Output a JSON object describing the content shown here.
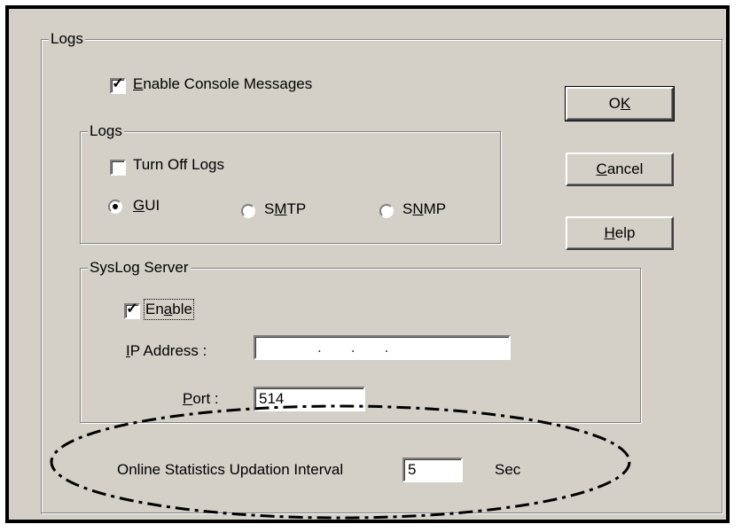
{
  "outer_group": {
    "legend": "Logs"
  },
  "console": {
    "label_first": "E",
    "label_rest": "nable Console Messages",
    "checked": true
  },
  "logs_group": {
    "legend": "Logs",
    "turn_off_label": "Turn Off Logs",
    "turn_off_checked": false,
    "radios": [
      {
        "pre": "",
        "u": "G",
        "post": "UI",
        "selected": true
      },
      {
        "pre": "S",
        "u": "M",
        "post": "TP",
        "selected": false
      },
      {
        "pre": "S",
        "u": "N",
        "post": "MP",
        "selected": false
      }
    ]
  },
  "syslog": {
    "legend": "SysLog Server",
    "enable_pre": "En",
    "enable_u": "a",
    "enable_post": "ble",
    "enable_checked": true,
    "ip_label_u": "I",
    "ip_label_rest": "P Address :",
    "ip_value": ".       .       .",
    "port_label_u": "P",
    "port_label_rest": "ort :",
    "port_value": "514"
  },
  "stats": {
    "label": "Online Statistics Updation Interval",
    "value": "5",
    "unit": "Sec"
  },
  "buttons": {
    "ok_pre": "O",
    "ok_u": "K",
    "cancel_u": "C",
    "cancel_rest": "ancel",
    "help_u": "H",
    "help_rest": "elp"
  }
}
